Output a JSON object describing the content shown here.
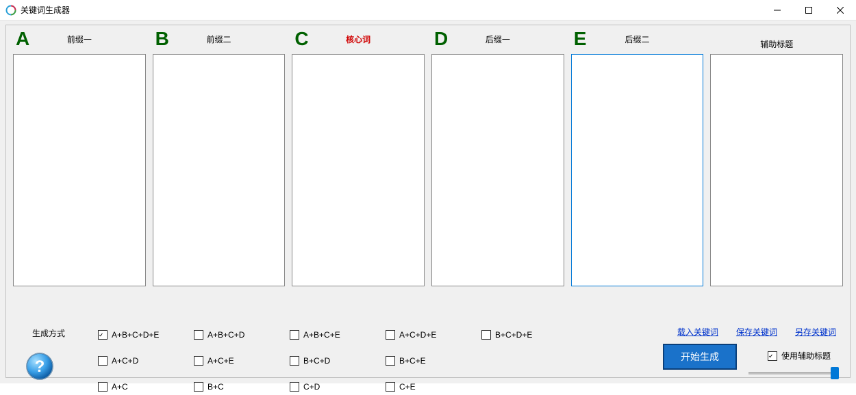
{
  "window": {
    "title": "关键词生成器"
  },
  "columns": [
    {
      "letter": "A",
      "label": "前缀一",
      "is_core": false
    },
    {
      "letter": "B",
      "label": "前缀二",
      "is_core": false
    },
    {
      "letter": "C",
      "label": "核心词",
      "is_core": true
    },
    {
      "letter": "D",
      "label": "后缀一",
      "is_core": false
    },
    {
      "letter": "E",
      "label": "后缀二",
      "is_core": false
    }
  ],
  "aux_column": {
    "label": "辅助标题"
  },
  "generate_label": "生成方式",
  "options": {
    "row1": [
      {
        "label": "A+B+C+D+E",
        "checked": true
      },
      {
        "label": "A+B+C+D",
        "checked": false
      },
      {
        "label": "A+B+C+E",
        "checked": false
      },
      {
        "label": "A+C+D+E",
        "checked": false
      },
      {
        "label": "B+C+D+E",
        "checked": false
      }
    ],
    "row2": [
      {
        "label": "A+C+D",
        "checked": false
      },
      {
        "label": "A+C+E",
        "checked": false
      },
      {
        "label": "B+C+D",
        "checked": false
      },
      {
        "label": "B+C+E",
        "checked": false
      }
    ],
    "row3": [
      {
        "label": "A+C",
        "checked": false
      },
      {
        "label": "B+C",
        "checked": false
      },
      {
        "label": "C+D",
        "checked": false
      },
      {
        "label": "C+E",
        "checked": false
      }
    ]
  },
  "links": {
    "load": "载入关键词",
    "save": "保存关键词",
    "save_as": "另存关键词"
  },
  "use_aux": {
    "label": "使用辅助标题",
    "checked": true
  },
  "start_button": "开始生成",
  "focused_column_index": 4
}
